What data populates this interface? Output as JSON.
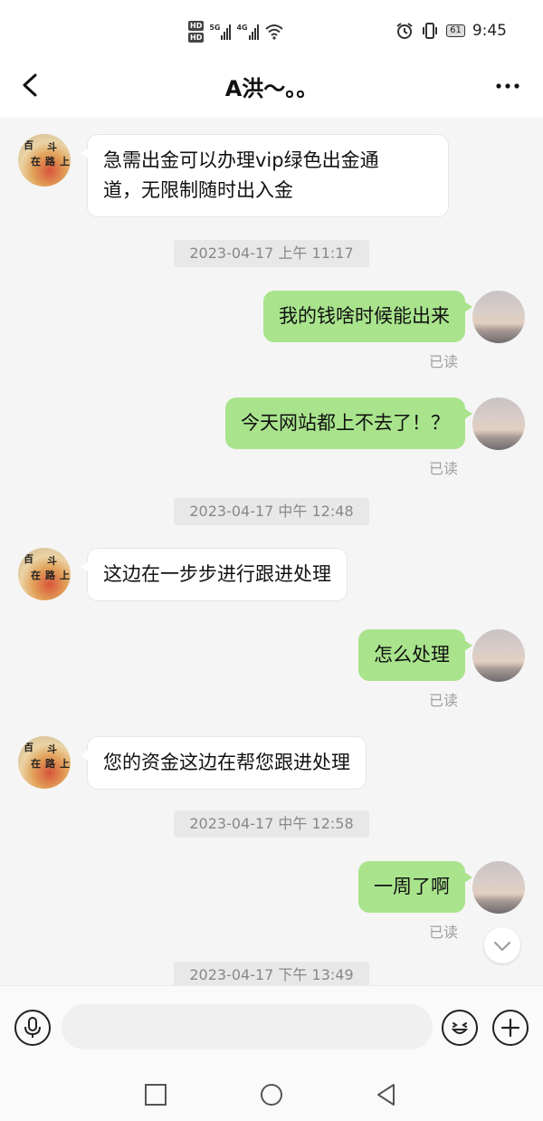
{
  "status_bar": {
    "hd1": "HD",
    "hd2": "HD",
    "net1": "5G",
    "net2": "4G",
    "battery": "61",
    "time": "9:45"
  },
  "header": {
    "title": "A洪～。。"
  },
  "messages": [
    {
      "kind": "in",
      "text_line1": "急需出金可以办理vip绿色出金通",
      "text_line2": "道，无限制随时出入金"
    },
    {
      "kind": "time",
      "text": "2023-04-17 上午 11:17"
    },
    {
      "kind": "out",
      "text": "我的钱啥时候能出来",
      "read": "已读"
    },
    {
      "kind": "out",
      "text": "今天网站都上不去了！？",
      "read": "已读"
    },
    {
      "kind": "time",
      "text": "2023-04-17 中午 12:48"
    },
    {
      "kind": "in",
      "text": "这边在一步步进行跟进处理"
    },
    {
      "kind": "out",
      "text": "怎么处理",
      "read": "已读"
    },
    {
      "kind": "in",
      "text": "您的资金这边在帮您跟进处理"
    },
    {
      "kind": "time",
      "text": "2023-04-17 中午 12:58"
    },
    {
      "kind": "out",
      "text": "一周了啊",
      "read": "已读"
    },
    {
      "kind": "time",
      "text": "2023-04-17 下午 13:49"
    }
  ],
  "avatar_peer": {
    "glyph1": "百",
    "glyph2": "斗",
    "glyph3": "在",
    "glyph4": "路",
    "glyph5": "上"
  },
  "input": {
    "placeholder": ""
  },
  "colors": {
    "outgoing_bubble": "#a9e48d",
    "incoming_bubble": "#ffffff",
    "background": "#f5f5f5"
  }
}
